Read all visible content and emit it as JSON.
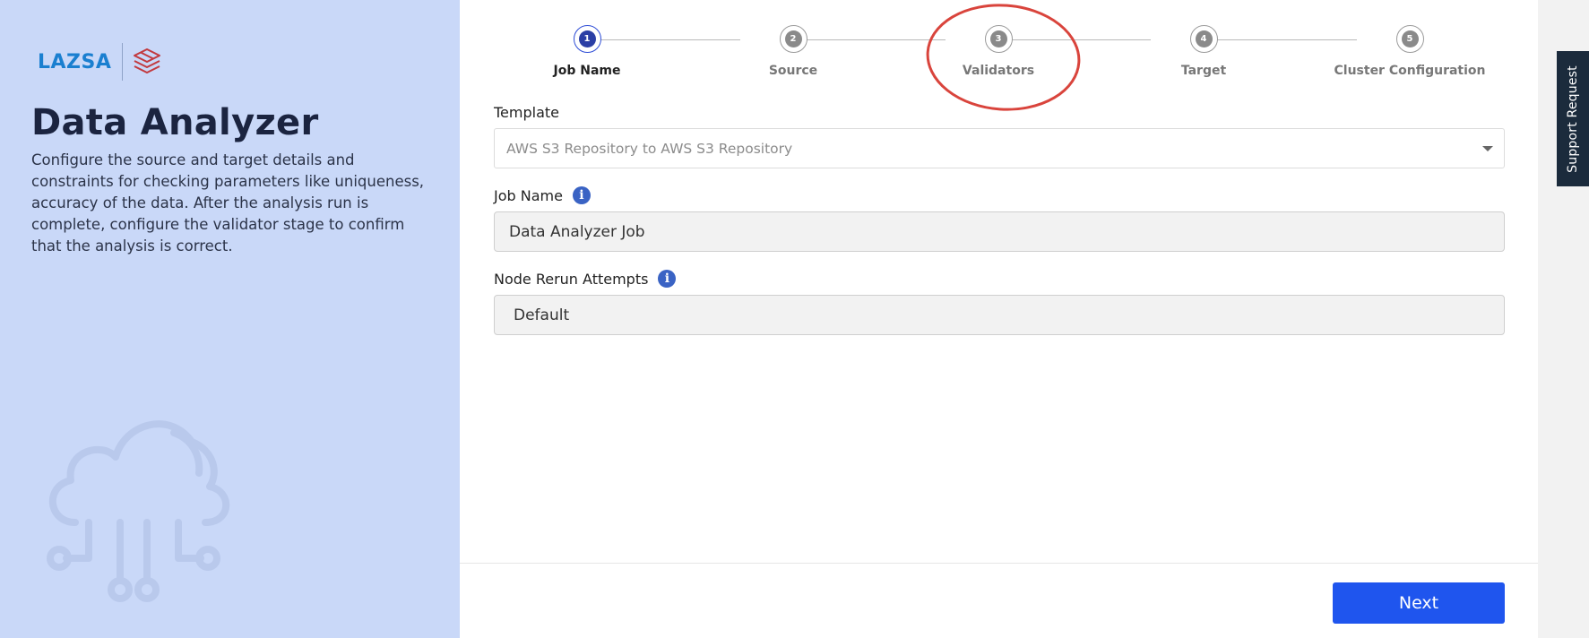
{
  "brand": {
    "logo_text": "LAZSA",
    "logo_color": "#1a7fd0",
    "mark_color": "#c2393e"
  },
  "left_panel": {
    "title": "Data Analyzer",
    "description": "Configure the source and target details and constraints for checking parameters like uniqueness, accuracy of the data. After the analysis run is complete, configure the validator stage to confirm that the analysis is correct.",
    "background": "#c9d8f8",
    "illustration_icon": "cloud-network-icon"
  },
  "stepper": {
    "current_step": 1,
    "highlighted_step": 3,
    "highlight_color": "#d9443c",
    "steps": [
      {
        "number": "1",
        "label": "Job Name"
      },
      {
        "number": "2",
        "label": "Source"
      },
      {
        "number": "3",
        "label": "Validators"
      },
      {
        "number": "4",
        "label": "Target"
      },
      {
        "number": "5",
        "label": "Cluster Configuration"
      }
    ]
  },
  "form": {
    "template": {
      "label": "Template",
      "value": "AWS S3 Repository to AWS S3 Repository"
    },
    "job_name": {
      "label": "Job Name",
      "value": "Data Analyzer Job",
      "info_icon": "i"
    },
    "node_rerun": {
      "label": "Node Rerun Attempts",
      "value": "Default",
      "info_icon": "i"
    }
  },
  "footer": {
    "next_label": "Next",
    "next_color": "#1f55ee"
  },
  "support": {
    "label": "Support Request"
  }
}
